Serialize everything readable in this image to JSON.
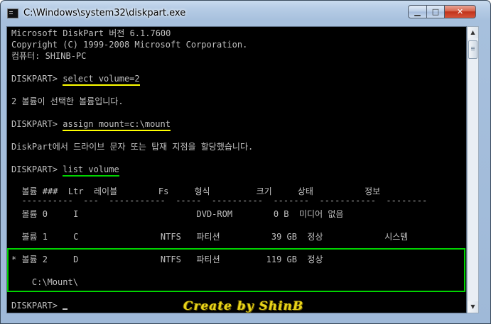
{
  "window": {
    "title": "C:\\Windows\\system32\\diskpart.exe",
    "min_glyph": "▁",
    "max_glyph": "□",
    "close_glyph": "✕"
  },
  "console": {
    "lines": [
      "Microsoft DiskPart 버전 6.1.7600",
      "Copyright (C) 1999-2008 Microsoft Corporation.",
      "컴퓨터: SHINB-PC"
    ],
    "prompt": "DISKPART> ",
    "cmd1": "select volume=2",
    "out1": "2 볼륨이 선택한 볼륨입니다.",
    "cmd2": "assign mount=c:\\mount",
    "out2": "DiskPart에서 드라이브 문자 또는 탑재 지점을 할당했습니다.",
    "cmd3": "list volume",
    "table": {
      "header": "  볼륨 ###  Ltr  레이블        Fs     형식         크기     상태          정보",
      "separator": "  ----------  ---  -----------  -----  ----------  -------  -----------  --------",
      "rows": [
        "  볼륨 0     I                       DVD-ROM        0 B  미디어 없음",
        "  볼륨 1     C                NTFS   파티션          39 GB  정상            시스템",
        "* 볼륨 2     D                NTFS   파티션         119 GB  정상",
        "    C:\\Mount\\"
      ]
    },
    "final_prompt": "DISKPART> "
  },
  "scrollbar": {
    "up": "▲",
    "down": "▼"
  },
  "watermark": "Create by ShinB",
  "colors": {
    "highlight_yellow": "#ffff00",
    "highlight_green": "#00d400",
    "console_text": "#c0c0c0"
  }
}
